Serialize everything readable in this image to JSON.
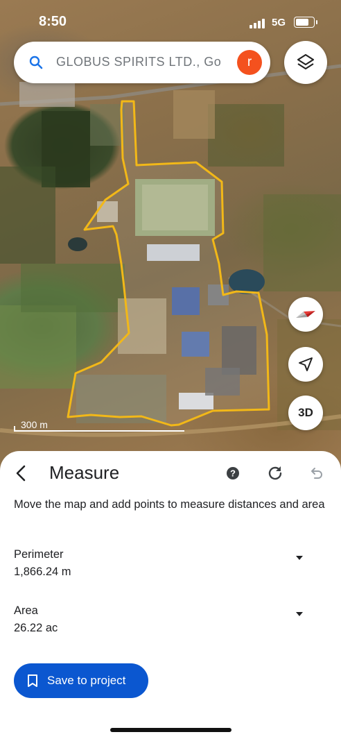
{
  "status_bar": {
    "time": "8:50",
    "network": "5G"
  },
  "search": {
    "query": "GLOBUS SPIRITS LTD., Go",
    "avatar_letter": "r",
    "avatar_color": "#f4511e"
  },
  "map": {
    "scale_label": "300 m",
    "boundary_color": "#f2b818",
    "buttons": {
      "three_d": "3D"
    },
    "icons": [
      "search-icon",
      "layers-icon",
      "compass-icon",
      "navigate-icon"
    ]
  },
  "measure_sheet": {
    "title": "Measure",
    "description": "Move the map and add points to measure distances and area",
    "perimeter": {
      "label": "Perimeter",
      "value": "1,866.24 m"
    },
    "area": {
      "label": "Area",
      "value": "26.22 ac"
    },
    "save_button": "Save to project",
    "accent_color": "#0b57d0"
  }
}
